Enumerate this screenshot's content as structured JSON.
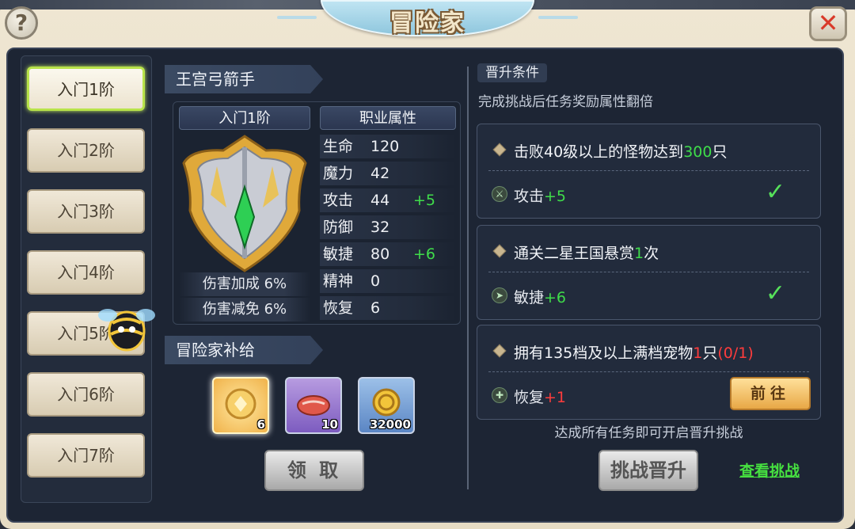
{
  "window": {
    "title": "冒险家"
  },
  "sidebar": {
    "items": [
      {
        "label": "入门1阶"
      },
      {
        "label": "入门2阶"
      },
      {
        "label": "入门3阶"
      },
      {
        "label": "入门4阶"
      },
      {
        "label": "入门5阶"
      },
      {
        "label": "入门6阶"
      },
      {
        "label": "入门7阶"
      }
    ],
    "active_index": 0
  },
  "class_panel": {
    "class_name": "王宫弓箭手",
    "tier_label": "入门1阶",
    "attr_header": "职业属性",
    "damage_bonus": "伤害加成 6%",
    "damage_reduction": "伤害减免 6%",
    "stats": [
      {
        "name": "生命",
        "value": "120",
        "bonus": ""
      },
      {
        "name": "魔力",
        "value": "42",
        "bonus": ""
      },
      {
        "name": "攻击",
        "value": "44",
        "bonus": "+5"
      },
      {
        "name": "防御",
        "value": "32",
        "bonus": ""
      },
      {
        "name": "敏捷",
        "value": "80",
        "bonus": "+6"
      },
      {
        "name": "精神",
        "value": "0",
        "bonus": ""
      },
      {
        "name": "恢复",
        "value": "6",
        "bonus": ""
      }
    ]
  },
  "supply": {
    "header": "冒险家补给",
    "items": [
      {
        "icon": "gold-badge-icon",
        "count": "6"
      },
      {
        "icon": "meat-icon",
        "count": "10"
      },
      {
        "icon": "gold-coin-icon",
        "count": "32000"
      }
    ],
    "claim_label": "领 取"
  },
  "promotion": {
    "section_label": "晋升条件",
    "description": "完成挑战后任务奖励属性翻倍",
    "tasks": [
      {
        "title_pre": "击败40级以上的怪物达到",
        "title_hl": "300",
        "title_post": "只",
        "title_progress": "",
        "reward_name": "攻击",
        "reward_value": "+5",
        "reward_icon": "attack-icon",
        "done": true
      },
      {
        "title_pre": "通关二星王国悬赏",
        "title_hl": "1",
        "title_post": "次",
        "title_progress": "",
        "reward_name": "敏捷",
        "reward_value": "+6",
        "reward_icon": "agility-icon",
        "done": true
      },
      {
        "title_pre": "拥有135档及以上满档宠物",
        "title_hl": "1",
        "title_post": "只",
        "title_progress": "(0/1)",
        "reward_name": "恢复",
        "reward_value": "+1",
        "reward_icon": "recovery-icon",
        "done": false
      }
    ],
    "goto_label": "前往",
    "footer_note": "达成所有任务即可开启晋升挑战",
    "challenge_label": "挑战晋升",
    "view_link": "查看挑战"
  },
  "colors": {
    "accent_green": "#3fdc4a",
    "progress_red": "#ff3c3c",
    "active_border": "#b8e34a"
  }
}
